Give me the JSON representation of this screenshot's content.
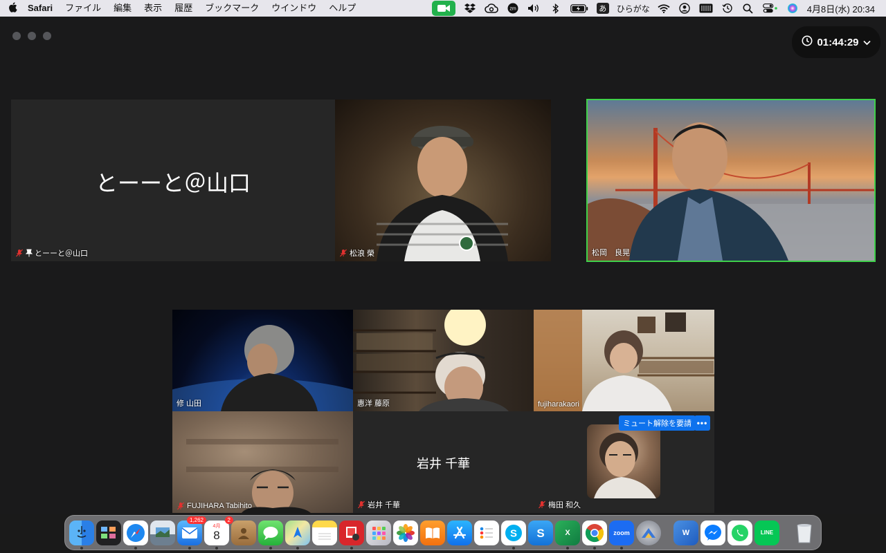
{
  "menubar": {
    "app_name": "Safari",
    "menus": [
      "ファイル",
      "編集",
      "表示",
      "履歴",
      "ブックマーク",
      "ウインドウ",
      "ヘルプ"
    ],
    "ime_glyph": "あ",
    "ime_label": "ひらがな",
    "datetime": "4月8日(水)  20:34"
  },
  "timer": {
    "elapsed": "01:44:29"
  },
  "participants": {
    "yamaguchi": {
      "name": "とーーと＠山口",
      "display": "とーーと＠山口"
    },
    "matsunami": {
      "name": "松浪 榮"
    },
    "matsuoka": {
      "name": "松岡　良晃"
    },
    "yamada": {
      "name": "修 山田"
    },
    "fujiwara": {
      "name": "惠洋 藤原"
    },
    "fujiharakaori": {
      "name": "fujiharakaori"
    },
    "tabihito": {
      "name": "FUJIHARA Tabihito"
    },
    "iwai": {
      "name": "岩井 千華",
      "display": "岩井 千華"
    },
    "umeda": {
      "name": "梅田 和久"
    }
  },
  "actions": {
    "ask_unmute": "ミュート解除を要請",
    "more": "•••"
  },
  "dock": {
    "mail_badge": "1,262",
    "calendar_month": "4月",
    "calendar_day": "8",
    "calendar_badge": "2",
    "zoom_label": "zoom",
    "excel_label": "X",
    "word_label": "W",
    "line_label": "LINE"
  },
  "colors": {
    "active_speaker": "#3fd14a",
    "zoom_blue": "#0e72ed",
    "mute_red": "#e0312f"
  }
}
